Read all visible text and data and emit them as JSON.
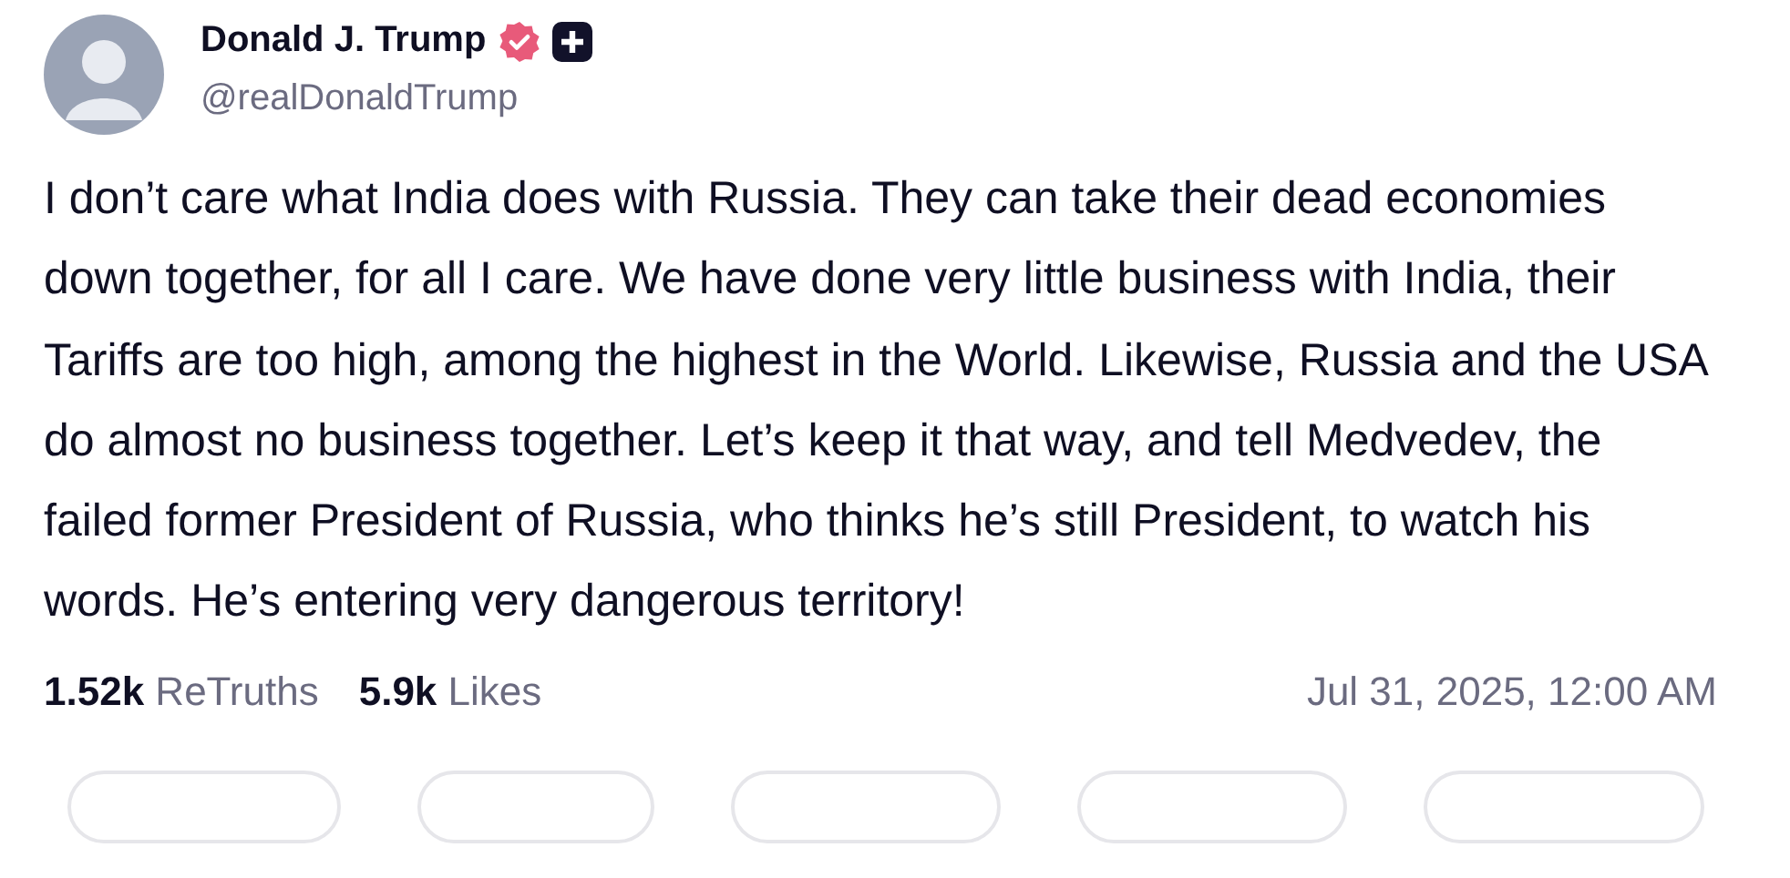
{
  "author": {
    "name": "Donald J. Trump",
    "handle": "@realDonaldTrump"
  },
  "post": {
    "text": "I don’t care what India does with Russia. They can take their dead economies down together, for all I care. We have done very little business with India, their Tariffs are too high, among the highest in the World. Likewise, Russia and the USA do almost no business together. Let’s keep it that way, and tell Medvedev, the failed former President of Russia, who thinks he’s still President, to watch his words. He’s entering very dangerous territory!"
  },
  "stats": [
    {
      "count": "1.52k",
      "label": "ReTruths"
    },
    {
      "count": "5.9k",
      "label": "Likes"
    }
  ],
  "timestamp": "Jul 31, 2025, 12:00 AM"
}
